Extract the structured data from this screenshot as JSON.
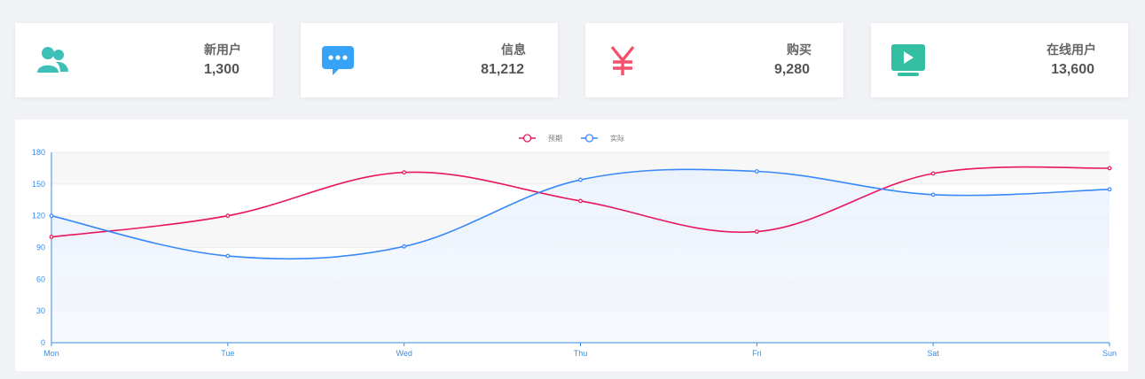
{
  "cards": [
    {
      "title": "新用户",
      "value": "1,300",
      "icon": "users-icon",
      "color": "#3ec0b8"
    },
    {
      "title": "信息",
      "value": "81,212",
      "icon": "message-icon",
      "color": "#36a3f7"
    },
    {
      "title": "购买",
      "value": "9,280",
      "icon": "yen-icon",
      "color": "#f4516c"
    },
    {
      "title": "在线用户",
      "value": "13,600",
      "icon": "video-screen-icon",
      "color": "#34bfa3"
    }
  ],
  "chart_data": {
    "type": "line",
    "categories": [
      "Mon",
      "Tue",
      "Wed",
      "Thu",
      "Fri",
      "Sat",
      "Sun"
    ],
    "series": [
      {
        "name": "预期",
        "values": [
          100,
          120,
          161,
          134,
          105,
          160,
          165
        ],
        "color": "#e8175d"
      },
      {
        "name": "实际",
        "values": [
          120,
          82,
          91,
          154,
          162,
          140,
          145
        ],
        "color": "#3888fa"
      }
    ],
    "ylim": [
      0,
      180
    ],
    "yticks": [
      0,
      30,
      60,
      90,
      120,
      150,
      180
    ],
    "grid": true,
    "legend_position": "top-center",
    "smooth": true
  }
}
